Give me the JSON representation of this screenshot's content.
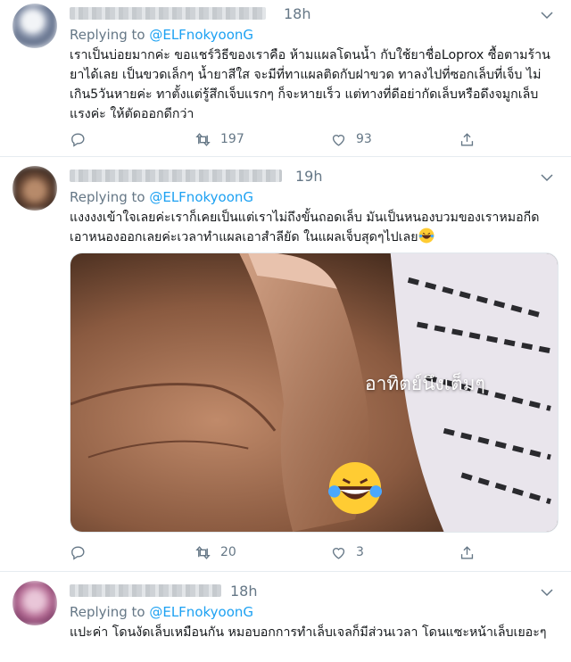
{
  "tweets": [
    {
      "time": "18h",
      "reply_prefix": "Replying to ",
      "reply_handle": "@ELFnokyoonG",
      "text": "เราเป็นบ่อยมากค่ะ ขอแชร์วิธีของเราคือ ห้ามแผลโดนน้ำ กับใช้ยาชื่อLoprox ซื้อตามร้านยาได้เลย เป็นขวดเล็กๆ น้ำยาสีใส จะมีที่ทาแผลติดกับฝาขวด ทาลงไปที่ซอกเล็บที่เจ็บ ไม่เกิน5วันหายค่ะ    ทาตั้งแต่รู้สึกเจ็บแรกๆ ก็จะหายเร็ว แต่ทางที่ดีอย่ากัดเล็บหรือดึงจมูกเล็บแรงค่ะ ให้ตัดออกดีกว่า",
      "retweets": "197",
      "likes": "93"
    },
    {
      "time": "19h",
      "reply_prefix": "Replying to ",
      "reply_handle": "@ELFnokyoonG",
      "text": "แงงงงเข้าใจเลยค่ะเราก็เคยเป็นแต่เราไม่ถึงขั้นถอดเล็บ มันเป็นหนองบวมของเราหมอกีดเอาหนองออกเลยค่ะเวลาทำแผลเอาสำลียัด ในแผลเจ็บสุดๆไปเลย",
      "image_caption": "อาทิตย์นึงเต็มๆ",
      "retweets": "20",
      "likes": "3"
    },
    {
      "time": "18h",
      "reply_prefix": "Replying to ",
      "reply_handle": "@ELFnokyoonG",
      "text": "แปะค่า โดนงัดเล็บเหมือนกัน หมอบอกการทำเล็บเจลก็มีส่วนเวลา โดนแซะหน้าเล็บเยอะๆ"
    }
  ],
  "colors": {
    "accent": "#1da1f2",
    "muted": "#657786",
    "text": "#14171a",
    "divider": "#e6ecf0"
  },
  "icons": [
    "chevron-down-icon",
    "reply-icon",
    "retweet-icon",
    "like-icon",
    "share-icon",
    "laughing-emoji-icon"
  ]
}
